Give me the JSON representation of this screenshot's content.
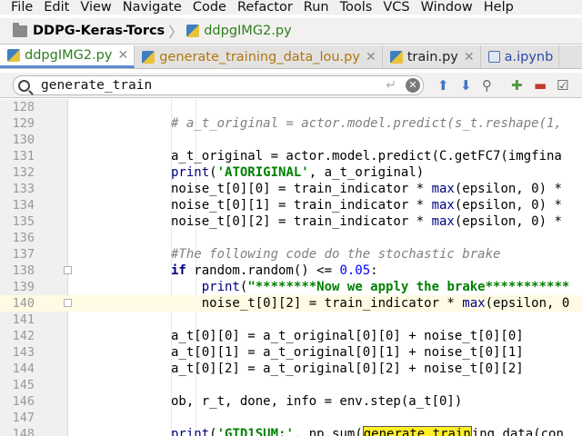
{
  "menu": [
    "File",
    "Edit",
    "View",
    "Navigate",
    "Code",
    "Refactor",
    "Run",
    "Tools",
    "VCS",
    "Window",
    "Help"
  ],
  "breadcrumb": {
    "project": "DDPG-Keras-Torcs",
    "file": "ddpgIMG2.py"
  },
  "tabs": [
    {
      "label": "ddpgIMG2.py",
      "active": true
    },
    {
      "label": "generate_training_data_lou.py",
      "active": false
    },
    {
      "label": "train.py",
      "active": false
    },
    {
      "label": "a.ipynb",
      "active": false
    }
  ],
  "search": {
    "query": "generate_train"
  },
  "editor": {
    "current_line": 140,
    "lines": [
      {
        "n": "128",
        "text": ""
      },
      {
        "n": "129",
        "text": "# a_t_original = actor.model.predict(s_t.reshape(1,"
      },
      {
        "n": "130",
        "text": ""
      },
      {
        "n": "131",
        "text": "a_t_original = actor.model.predict(C.getFC7(imgfina"
      },
      {
        "n": "132",
        "text": "print('ATORIGINAL', a_t_original)"
      },
      {
        "n": "133",
        "text": "noise_t[0][0] = train_indicator * max(epsilon, 0) *"
      },
      {
        "n": "134",
        "text": "noise_t[0][1] = train_indicator * max(epsilon, 0) *"
      },
      {
        "n": "135",
        "text": "noise_t[0][2] = train_indicator * max(epsilon, 0) *"
      },
      {
        "n": "136",
        "text": ""
      },
      {
        "n": "137",
        "text": "#The following code do the stochastic brake"
      },
      {
        "n": "138",
        "text": "if random.random() <= 0.05:"
      },
      {
        "n": "139",
        "text": "    print(\"********Now we apply the brake***********"
      },
      {
        "n": "140",
        "text": "    noise_t[0][2] = train_indicator * max(epsilon, 0"
      },
      {
        "n": "141",
        "text": ""
      },
      {
        "n": "142",
        "text": "a_t[0][0] = a_t_original[0][0] + noise_t[0][0]"
      },
      {
        "n": "143",
        "text": "a_t[0][1] = a_t_original[0][1] + noise_t[0][1]"
      },
      {
        "n": "144",
        "text": "a_t[0][2] = a_t_original[0][2] + noise_t[0][2]"
      },
      {
        "n": "145",
        "text": ""
      },
      {
        "n": "146",
        "text": "ob, r_t, done, info = env.step(a_t[0])"
      },
      {
        "n": "147",
        "text": ""
      },
      {
        "n": "148",
        "text": "print('GTD1SUM:', np.sum(generate_training_data(con"
      }
    ]
  }
}
